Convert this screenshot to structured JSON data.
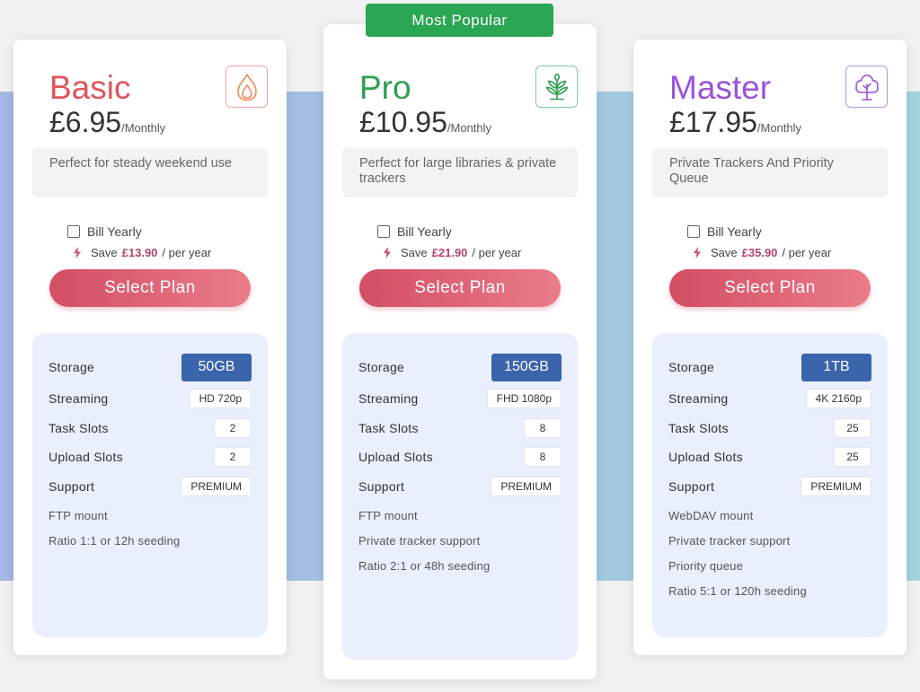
{
  "badge": {
    "label": "Most Popular"
  },
  "colors": {
    "basic_name": "#e0555d",
    "pro_name": "#2ea04f",
    "master_name": "#9a52dc",
    "save_amount": "#b2476a",
    "button_start": "#d24e64",
    "button_end": "#ea7c8a",
    "storage_badge": "#3a64ab",
    "popular_badge": "#2aa654"
  },
  "plans": [
    {
      "key": "basic",
      "name": "Basic",
      "icon": "flame-icon",
      "price": "£6.95",
      "period": "/Monthly",
      "description": "Perfect for steady weekend use",
      "bill_yearly": "Bill Yearly",
      "save_prefix": "Save",
      "save_amount": "£13.90",
      "save_suffix": "/ per year",
      "button": "Select Plan",
      "features": [
        {
          "label": "Storage",
          "value": "50GB"
        },
        {
          "label": "Streaming",
          "value": "HD 720p"
        },
        {
          "label": "Task Slots",
          "value": "2"
        },
        {
          "label": "Upload Slots",
          "value": "2"
        },
        {
          "label": "Support",
          "value": "PREMIUM"
        }
      ],
      "extras": [
        "FTP mount",
        "Ratio 1:1 or 12h seeding"
      ]
    },
    {
      "key": "pro",
      "name": "Pro",
      "icon": "sprout-icon",
      "price": "£10.95",
      "period": "/Monthly",
      "description": "Perfect for large libraries & private trackers",
      "bill_yearly": "Bill Yearly",
      "save_prefix": "Save",
      "save_amount": "£21.90",
      "save_suffix": "/ per year",
      "button": "Select Plan",
      "features": [
        {
          "label": "Storage",
          "value": "150GB"
        },
        {
          "label": "Streaming",
          "value": "FHD 1080p"
        },
        {
          "label": "Task Slots",
          "value": "8"
        },
        {
          "label": "Upload Slots",
          "value": "8"
        },
        {
          "label": "Support",
          "value": "PREMIUM"
        }
      ],
      "extras": [
        "FTP mount",
        "Private tracker support",
        "Ratio 2:1 or 48h seeding"
      ]
    },
    {
      "key": "master",
      "name": "Master",
      "icon": "tree-icon",
      "price": "£17.95",
      "period": "/Monthly",
      "description": "Private Trackers And Priority Queue",
      "bill_yearly": "Bill Yearly",
      "save_prefix": "Save",
      "save_amount": "£35.90",
      "save_suffix": "/ per year",
      "button": "Select Plan",
      "features": [
        {
          "label": "Storage",
          "value": "1TB"
        },
        {
          "label": "Streaming",
          "value": "4K 2160p"
        },
        {
          "label": "Task Slots",
          "value": "25"
        },
        {
          "label": "Upload Slots",
          "value": "25"
        },
        {
          "label": "Support",
          "value": "PREMIUM"
        }
      ],
      "extras": [
        "WebDAV mount",
        "Private tracker support",
        "Priority queue",
        "Ratio 5:1 or 120h seeding"
      ]
    }
  ]
}
